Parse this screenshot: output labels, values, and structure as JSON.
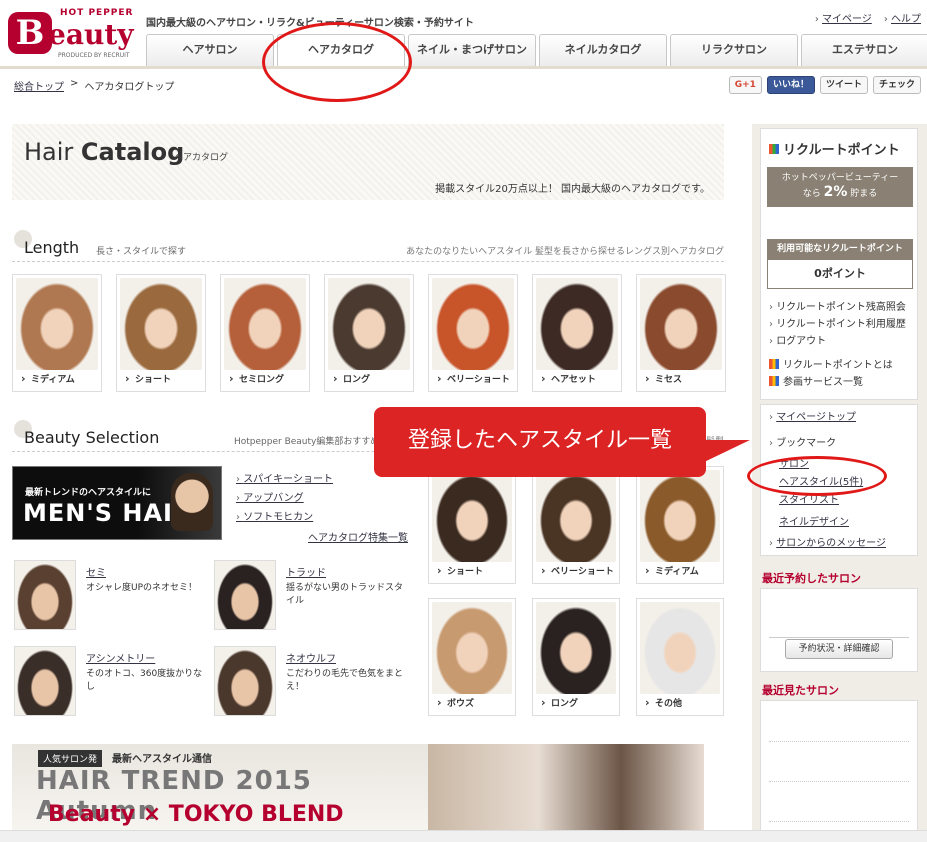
{
  "header": {
    "logo_top": "HOT PEPPER",
    "logo_mark": "B",
    "logo_word": "eauty",
    "logo_produced": "PRODUCED BY RECRUIT",
    "tagline": "国内最大級のヘアサロン・リラク&ビューティーサロン検索・予約サイト",
    "links": [
      "マイページ",
      "ヘルプ"
    ]
  },
  "nav": {
    "tabs": [
      "ヘアサロン",
      "ヘアカタログ",
      "ネイル・まつげサロン",
      "ネイルカタログ",
      "リラクサロン",
      "エステサロン"
    ],
    "active_index": 1
  },
  "breadcrumb": {
    "home": "総合トップ",
    "sep": ">",
    "current": "ヘアカタログトップ"
  },
  "social": {
    "gplus": "G+1",
    "facebook": "いいね！",
    "twitter": "ツイート",
    "check": "チェック"
  },
  "hero": {
    "title_light": "Hair ",
    "title_bold": "Catalog",
    "subtitle": "ヘアカタログ",
    "description": "掲載スタイル20万点以上！ 国内最大級のヘアカタログです。"
  },
  "length_section": {
    "title": "Length",
    "sub": "長さ・スタイルで探す",
    "desc": "あなたのなりたいヘアスタイル 髪型を長さから探せるレングス別ヘアカタログ",
    "items": [
      {
        "label": "ミディアム",
        "color": "#b07850"
      },
      {
        "label": "ショート",
        "color": "#9a6a3e"
      },
      {
        "label": "セミロング",
        "color": "#b5603a"
      },
      {
        "label": "ロング",
        "color": "#4a3a30"
      },
      {
        "label": "ベリーショート",
        "color": "#c8542a"
      },
      {
        "label": "ヘアセット",
        "color": "#3d2a24"
      },
      {
        "label": "ミセス",
        "color": "#8a4a2e"
      }
    ]
  },
  "beauty_section": {
    "title": "Beauty Selection",
    "sub": "Hotpepper Beauty編集部おすすめ",
    "desc_tail": "髪型",
    "banner_line1": "最新トレンドのヘアスタイルに",
    "banner_line2": "MEN'S HAIR",
    "links": [
      "スパイキーショート",
      "アップバング",
      "ソフトモヒカン"
    ],
    "feature_link": "ヘアカタログ特集一覧",
    "people": [
      {
        "name": "セミ",
        "desc": "オシャレ度UPのネオセミ！",
        "color": "#5a4030"
      },
      {
        "name": "トラッド",
        "desc": "揺るがない男のトラッドスタイル",
        "color": "#2a2220"
      },
      {
        "name": "アシンメトリー",
        "desc": "そのオトコ、360度抜かりなし",
        "color": "#3a2e28"
      },
      {
        "name": "ネオウルフ",
        "desc": "こだわりの毛先で色気をまとえ！",
        "color": "#4a382c"
      }
    ],
    "men_thumbs": [
      {
        "label": "ショート",
        "color": "#3a2a20"
      },
      {
        "label": "ベリーショート",
        "color": "#4a3424"
      },
      {
        "label": "ミディアム",
        "color": "#8a5a2a"
      },
      {
        "label": "ボウズ",
        "color": "#c89a70"
      },
      {
        "label": "ロング",
        "color": "#2a2220"
      },
      {
        "label": "その他",
        "color": "#e6e6e6"
      }
    ]
  },
  "trend_banner": {
    "badge": "人気サロン発",
    "headline": "最新ヘアスタイル通信",
    "big": "HAIR TREND 2015 Autumn",
    "brand": "Beauty × TOKYO BLEND"
  },
  "sidebar": {
    "rp_logo": "リクルートポイント",
    "promo_line1": "ホットペッパービューティー",
    "promo_line2_pre": "なら ",
    "promo_pct": "2%",
    "promo_line2_post": " 貯まる",
    "points_head": "利用可能なリクルートポイント",
    "points_value": "0ポイント",
    "rp_links": [
      "リクルートポイント残高照会",
      "リクルートポイント利用履歴",
      "ログアウト"
    ],
    "rp_info": [
      "リクルートポイントとは",
      "参画サービス一覧"
    ],
    "mypage": "マイページトップ",
    "bookmark": "ブックマーク",
    "bm_salon": "サロン",
    "bm_hairstyle": "ヘアスタイル(5件)",
    "bm_stylist": "スタイリスト",
    "bm_nail": "ネイルデザイン",
    "salon_msg": "サロンからのメッセージ",
    "recent_reserved": "最近予約したサロン",
    "reserve_btn": "予約状況・詳細確認",
    "recent_viewed": "最近見たサロン"
  },
  "callout": {
    "text": "登録したヘアスタイル一覧",
    "accent": "#dd2424"
  }
}
